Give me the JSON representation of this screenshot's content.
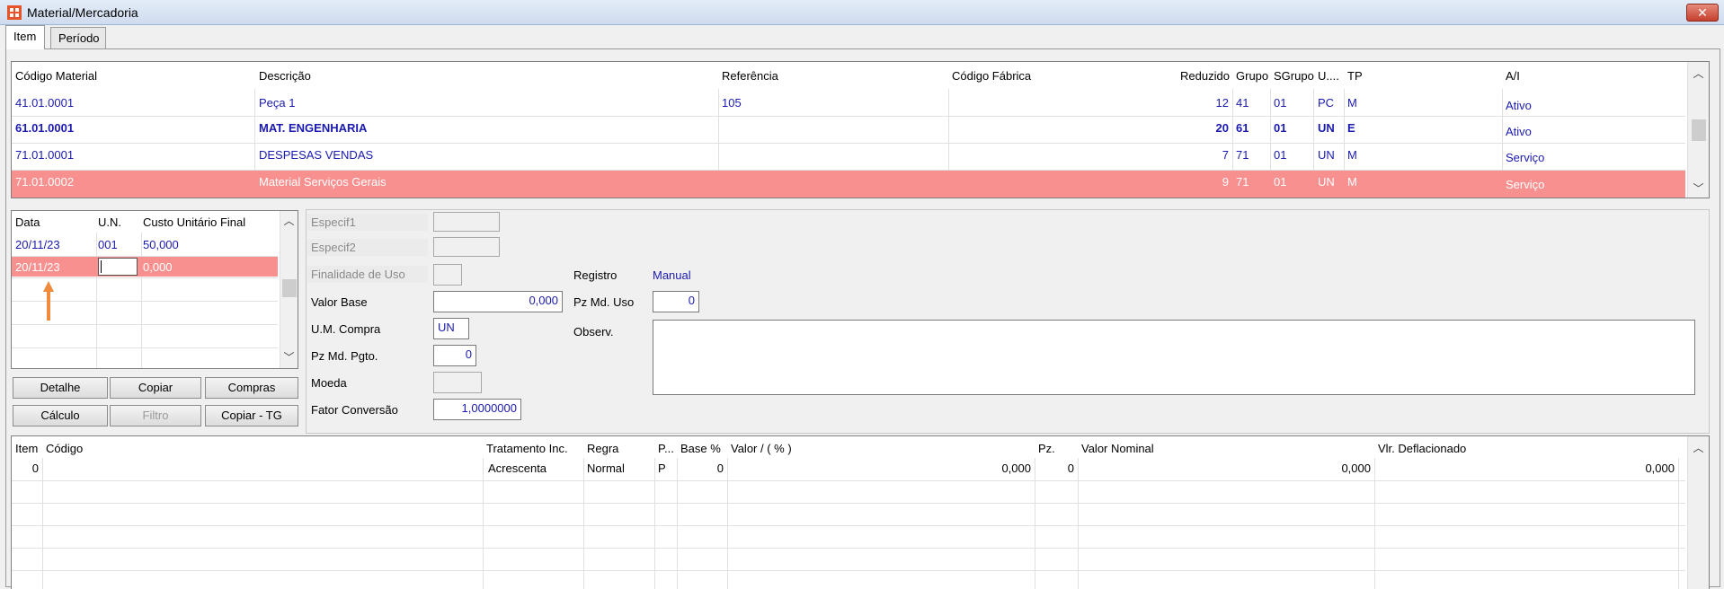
{
  "window": {
    "title": "Material/Mercadoria",
    "close_symbol": "✕"
  },
  "tabs": [
    {
      "label": "Item"
    },
    {
      "label": "Período"
    }
  ],
  "materials": {
    "headers": [
      "Código Material",
      "Descrição",
      "Referência",
      "Código Fábrica",
      "Reduzido",
      "Grupo",
      "SGrupo",
      "U....",
      "TP",
      "A/I"
    ],
    "rows": [
      {
        "codigo": "41.01.0001",
        "descricao": "Peça 1",
        "referencia": "105",
        "fabrica": "",
        "reduzido": "12",
        "grupo": "41",
        "sgrupo": "01",
        "un": "PC",
        "tp": "M",
        "ai": "Ativo"
      },
      {
        "codigo": "61.01.0001",
        "descricao": "MAT. ENGENHARIA",
        "referencia": "",
        "fabrica": "",
        "reduzido": "20",
        "grupo": "61",
        "sgrupo": "01",
        "un": "UN",
        "tp": "E",
        "ai": "Ativo"
      },
      {
        "codigo": "71.01.0001",
        "descricao": "DESPESAS VENDAS",
        "referencia": "",
        "fabrica": "",
        "reduzido": "7",
        "grupo": "71",
        "sgrupo": "01",
        "un": "UN",
        "tp": "M",
        "ai": "Serviço"
      },
      {
        "codigo": "71.01.0002",
        "descricao": "Material Serviços Gerais",
        "referencia": "",
        "fabrica": "",
        "reduzido": "9",
        "grupo": "71",
        "sgrupo": "01",
        "un": "UN",
        "tp": "M",
        "ai": "Serviço"
      }
    ]
  },
  "costs": {
    "headers": [
      "Data",
      "U.N.",
      "Custo Unitário Final"
    ],
    "rows": [
      {
        "data": "20/11/23",
        "un": "001",
        "custo": "50,000"
      },
      {
        "data": "20/11/23",
        "un": "",
        "custo": "0,000"
      }
    ]
  },
  "buttons": {
    "detalhe": "Detalhe",
    "copiar": "Copiar",
    "compras": "Compras",
    "calculo": "Cálculo",
    "filtro": "Filtro",
    "copiar_tg": "Copiar - TG"
  },
  "form": {
    "especif1_label": "Especif1",
    "especif2_label": "Especif2",
    "finalidade_label": "Finalidade de Uso",
    "valor_base_label": "Valor Base",
    "valor_base": "0,000",
    "um_compra_label": "U.M. Compra",
    "um_compra": "UN",
    "pz_md_pgto_label": "Pz Md. Pgto.",
    "pz_md_pgto": "0",
    "moeda_label": "Moeda",
    "moeda": "",
    "fator_label": "Fator Conversão",
    "fator": "1,0000000",
    "registro_label": "Registro",
    "registro": "Manual",
    "pz_md_uso_label": "Pz Md. Uso",
    "pz_md_uso": "0",
    "observ_label": "Observ."
  },
  "bottom": {
    "headers": [
      "Item",
      "Código",
      "Tratamento Inc.",
      "Regra",
      "P...",
      "Base %",
      "Valor / ( % )",
      "Pz.",
      "Valor Nominal",
      "Vlr. Deflacionado"
    ],
    "rows": [
      {
        "item": "0",
        "codigo": "",
        "tratamento": "Acrescenta",
        "regra": "Normal",
        "p": "P",
        "base": "0",
        "valor": "0,000",
        "pz": "0",
        "nominal": "0,000",
        "deflacionado": "0,000"
      }
    ]
  },
  "colors": {
    "selection": "#f99090",
    "value_text": "#1a1ab0",
    "arrow": "#f08a3c"
  }
}
